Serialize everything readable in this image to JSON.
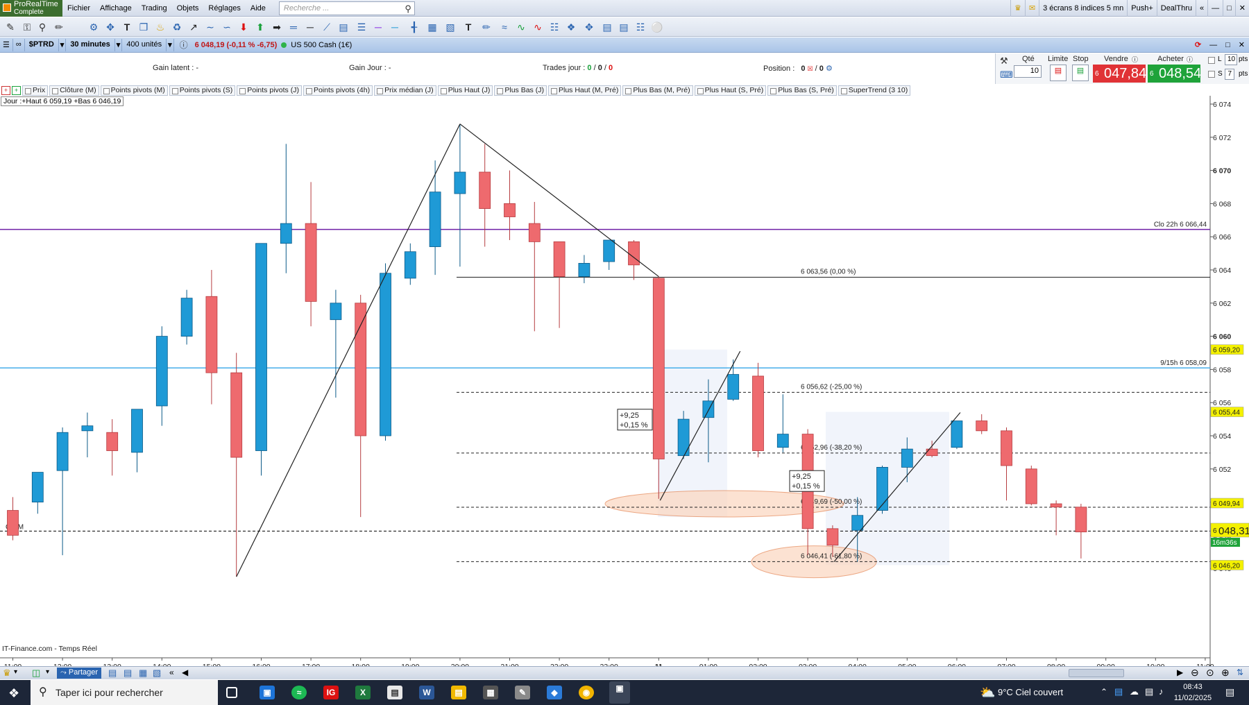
{
  "menubar": {
    "logo_line1": "ProRealTime",
    "logo_line2": "Complete",
    "items": [
      "Fichier",
      "Affichage",
      "Trading",
      "Objets",
      "Réglages",
      "Aide"
    ],
    "search_placeholder": "Recherche ...",
    "right": {
      "screens": "3 écrans 8 indices 5 mn",
      "push": "Push+",
      "dealthru": "DealThru"
    }
  },
  "chart_header": {
    "symbol": "$PTRD",
    "interval": "30 minutes",
    "units": "400 unités",
    "quote": "6 048,19 (-0,11 % -6,75)",
    "instrument": "US 500 Cash (1€)"
  },
  "infobar": {
    "gain_latent_label": "Gain latent :",
    "gain_latent_value": "-",
    "gain_jour_label": "Gain Jour :",
    "gain_jour_value": "-",
    "trades_label": "Trades jour :",
    "trades_v1": "0",
    "trades_v2": "0",
    "trades_v3": "0",
    "position_label": "Position :",
    "position_v1": "0",
    "position_v2": "0"
  },
  "order_panel": {
    "qte_label": "Qté",
    "qte_value": "10",
    "limite_label": "Limite",
    "stop_label": "Stop",
    "vendre_label": "Vendre",
    "vendre_prefix": "6",
    "vendre_price": "047,84",
    "acheter_label": "Acheter",
    "acheter_prefix": "6",
    "acheter_price": "048,54",
    "l_label": "L",
    "l_value": "10",
    "s_label": "S",
    "s_value": "7",
    "pts": "pts"
  },
  "legend": [
    "Prix",
    "Clôture (M)",
    "Points pivots (M)",
    "Points pivots (S)",
    "Points pivots (J)",
    "Points pivots (4h)",
    "Prix médian (J)",
    "Plus Haut (J)",
    "Plus Bas (J)",
    "Plus Haut (M, Pré)",
    "Plus Bas (M, Pré)",
    "Plus Haut (S, Pré)",
    "Plus Bas (S, Pré)",
    "SuperTrend (3 10)"
  ],
  "jour_box": "Jour :+Haut 6 059,19 +Bas 6 046,19",
  "source": "IT-Finance.com - Temps Réel",
  "chart_data": {
    "type": "candlestick",
    "y_ticks": [
      "6 074",
      "6 072",
      "6 070",
      "6 068",
      "6 066",
      "6 064",
      "6 062",
      "6 060",
      "6 058",
      "6 056",
      "6 054",
      "6 052",
      "6 050",
      "6 048",
      "6 046"
    ],
    "y_bold": [
      "6 070",
      "6 060"
    ],
    "x_ticks": [
      "11:00",
      "12:00",
      "13:00",
      "14:00",
      "15:00",
      "16:00",
      "17:00",
      "18:00",
      "19:00",
      "20:00",
      "21:00",
      "22:00",
      "23:00",
      "11",
      "01:00",
      "02:00",
      "03:00",
      "04:00",
      "05:00",
      "06:00",
      "07:00",
      "08:00",
      "09:00",
      "10:00",
      "11:00"
    ],
    "candles": [
      [
        6049.5,
        6050.3,
        6047.7,
        6048.0
      ],
      [
        6050.0,
        6051.7,
        6049.3,
        6051.8
      ],
      [
        6051.9,
        6054.5,
        6046.8,
        6054.2
      ],
      [
        6054.3,
        6055.4,
        6052.7,
        6054.6
      ],
      [
        6054.2,
        6055.0,
        6051.6,
        6053.1
      ],
      [
        6053.0,
        6055.6,
        6051.8,
        6055.6
      ],
      [
        6055.8,
        6060.6,
        6054.6,
        6060.0
      ],
      [
        6060.0,
        6062.8,
        6059.5,
        6062.3
      ],
      [
        6062.4,
        6064.0,
        6055.9,
        6057.8
      ],
      [
        6057.8,
        6059.0,
        6045.5,
        6052.7
      ],
      [
        6053.1,
        6064.1,
        6051.6,
        6065.6
      ],
      [
        6065.6,
        6071.6,
        6063.8,
        6066.8
      ],
      [
        6066.8,
        6069.3,
        6060.6,
        6062.1
      ],
      [
        6061.0,
        6062.8,
        6056.3,
        6062.0
      ],
      [
        6062.0,
        6062.5,
        6049.1,
        6054.0
      ],
      [
        6054.0,
        6064.4,
        6053.7,
        6063.8
      ],
      [
        6063.5,
        6065.6,
        6063.1,
        6065.1
      ],
      [
        6065.4,
        6070.6,
        6063.7,
        6068.7
      ],
      [
        6068.6,
        6072.8,
        6064.2,
        6069.9
      ],
      [
        6069.9,
        6071.6,
        6065.4,
        6067.7
      ],
      [
        6068.0,
        6070.0,
        6065.8,
        6067.2
      ],
      [
        6066.8,
        6068.1,
        6060.3,
        6065.7
      ],
      [
        6065.7,
        6065.7,
        6060.5,
        6063.6
      ],
      [
        6063.6,
        6064.9,
        6063.2,
        6064.4
      ],
      [
        6064.5,
        6065.8,
        6064.0,
        6065.8
      ],
      [
        6065.7,
        6065.8,
        6063.4,
        6064.3
      ],
      [
        6063.5,
        6063.6,
        6050.2,
        6052.6
      ],
      [
        6052.8,
        6055.5,
        6052.6,
        6055.0
      ],
      [
        6055.1,
        6057.4,
        6052.4,
        6056.1
      ],
      [
        6056.2,
        6058.6,
        6056.1,
        6057.7
      ],
      [
        6057.6,
        6058.4,
        6052.7,
        6053.1
      ],
      [
        6053.3,
        6056.5,
        6053.0,
        6054.1
      ],
      [
        6054.1,
        6054.4,
        6046.8,
        6048.4
      ],
      [
        6048.4,
        6048.6,
        6046.7,
        6047.4
      ],
      [
        6048.3,
        6050.3,
        6046.4,
        6049.2
      ],
      [
        6049.5,
        6052.2,
        6049.3,
        6052.1
      ],
      [
        6052.1,
        6053.9,
        6051.2,
        6053.2
      ],
      [
        6053.2,
        6053.7,
        6052.7,
        6052.8
      ],
      [
        6053.3,
        6054.9,
        6053.2,
        6054.9
      ],
      [
        6054.9,
        6055.3,
        6054.1,
        6054.3
      ],
      [
        6054.3,
        6054.5,
        6050.1,
        6052.2
      ],
      [
        6052.0,
        6052.2,
        6049.8,
        6049.9
      ],
      [
        6049.9,
        6050.1,
        6048.0,
        6049.7
      ],
      [
        6049.7,
        6049.9,
        6046.6,
        6048.2
      ]
    ],
    "hlines": [
      {
        "label": "Clo 22h 6 066,44",
        "value": 6066.44,
        "color": "#6f1fa6",
        "style": "solid"
      },
      {
        "label": "9/15h 6 058,09",
        "value": 6058.09,
        "color": "#45aeea",
        "style": "solid"
      },
      {
        "label": "Clo M",
        "value": 6048.25,
        "color": "#000000",
        "style": "dashed"
      }
    ],
    "fib_levels": [
      {
        "label": "6 063,56 (0,00 %)",
        "value": 6063.56,
        "style": "solid"
      },
      {
        "label": "6 056,62 (-25,00 %)",
        "value": 6056.62,
        "style": "dashed"
      },
      {
        "label": "6 052,96 (-38,20 %)",
        "value": 6052.96,
        "style": "dashed"
      },
      {
        "label": "6 049,69 (-50,00 %)",
        "value": 6049.69,
        "style": "dashed"
      },
      {
        "label": "6 046,41 (-61,80 %)",
        "value": 6046.41,
        "style": "dashed"
      }
    ],
    "boxes": [
      {
        "line1": "+9,25",
        "line2": "+0,15 %"
      },
      {
        "line1": "+9,25",
        "line2": "+0,15 %"
      }
    ],
    "price_tags": [
      {
        "label": "6 059,20",
        "value": 6059.2,
        "color": "#f4f100"
      },
      {
        "label": "6 055,44",
        "value": 6055.44,
        "color": "#f4f100"
      },
      {
        "label": "6 049,94",
        "value": 6049.94,
        "color": "#f4f100"
      },
      {
        "label": "6 046,20",
        "value": 6046.2,
        "color": "#f4f100"
      }
    ],
    "last_price": {
      "prefix": "6",
      "label": "048,31",
      "value": 6048.31,
      "timer": "16m36s"
    },
    "colors": {
      "up": "#1f9ad6",
      "down": "#ee6a6e",
      "up_border": "#0b5a88",
      "down_border": "#b63c40"
    }
  },
  "taskbar": {
    "search": "Taper ici pour rechercher",
    "weather": "9°C  Ciel couvert",
    "time": "08:43",
    "date": "11/02/2025"
  }
}
